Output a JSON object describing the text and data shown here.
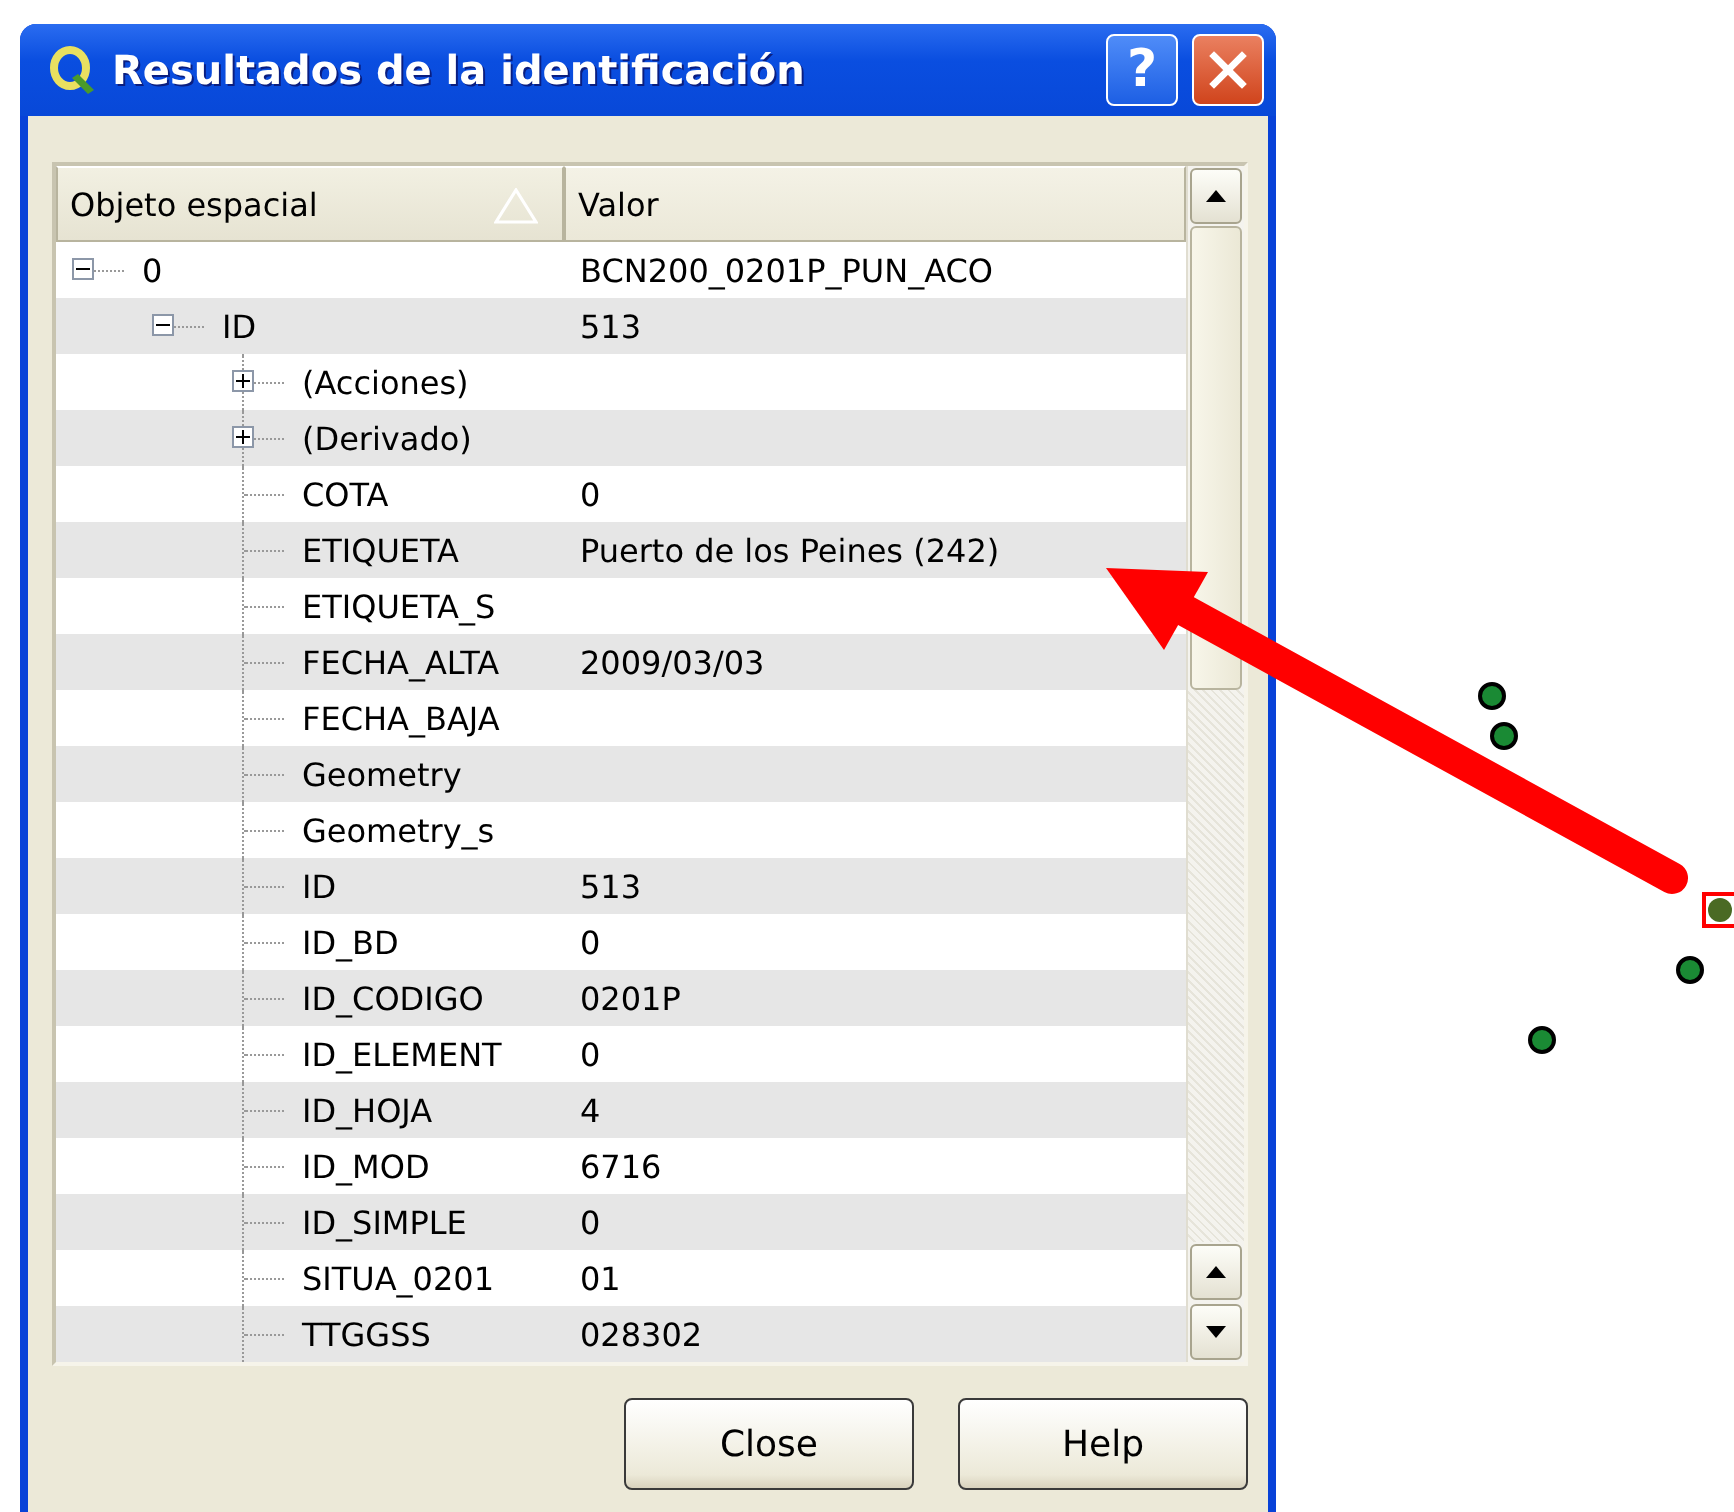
{
  "window": {
    "title": "Resultados de la identificación",
    "help_button": "?"
  },
  "tree": {
    "columns": [
      {
        "label": "Objeto espacial",
        "sorted": true
      },
      {
        "label": "Valor",
        "sorted": false
      }
    ],
    "items": [
      {
        "label": "0",
        "value": "BCN200_0201P_PUN_ACO",
        "expanded": true,
        "children": [
          {
            "label": "ID",
            "value": "513",
            "expanded": true,
            "children": [
              {
                "label": "(Acciones)",
                "expanded": false
              },
              {
                "label": "(Derivado)",
                "expanded": false
              },
              {
                "label": "COTA",
                "value": "0"
              },
              {
                "label": "ETIQUETA",
                "value": "Puerto de los Peines (242)"
              },
              {
                "label": "ETIQUETA_S"
              },
              {
                "label": "FECHA_ALTA",
                "value": "2009/03/03"
              },
              {
                "label": "FECHA_BAJA"
              },
              {
                "label": "Geometry"
              },
              {
                "label": "Geometry_s"
              },
              {
                "label": "ID",
                "value": "513"
              },
              {
                "label": "ID_BD",
                "value": "0"
              },
              {
                "label": "ID_CODIGO",
                "value": "0201P"
              },
              {
                "label": "ID_ELEMENT",
                "value": "0"
              },
              {
                "label": "ID_HOJA",
                "value": "4"
              },
              {
                "label": "ID_MOD",
                "value": "6716"
              },
              {
                "label": "ID_SIMPLE",
                "value": "0"
              },
              {
                "label": "SITUA_0201",
                "value": "01"
              },
              {
                "label": "TTGGSS",
                "value": "028302"
              }
            ]
          }
        ]
      }
    ]
  },
  "buttons": [
    {
      "label": "Close"
    },
    {
      "label": "Help"
    }
  ]
}
